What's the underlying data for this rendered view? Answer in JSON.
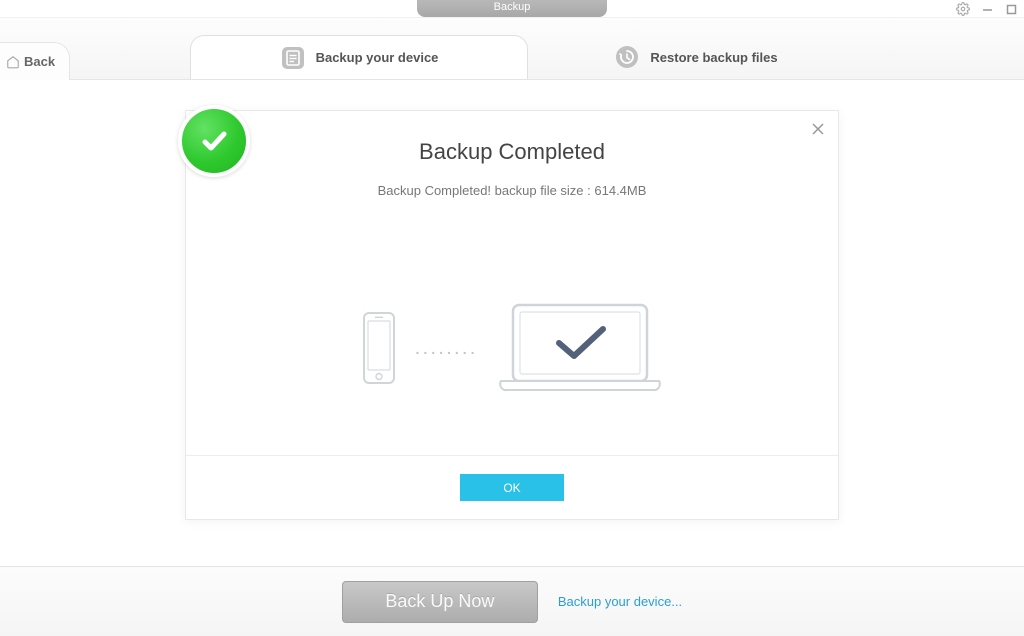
{
  "window": {
    "title": "Backup"
  },
  "nav": {
    "back_label": "Back"
  },
  "tabs": {
    "backup_label": "Backup your device",
    "restore_label": "Restore backup files"
  },
  "dialog": {
    "title": "Backup Completed",
    "subtitle": "Backup Completed! backup file size : 614.4MB",
    "ok_label": "OK",
    "dots": "........"
  },
  "footer": {
    "backup_now_label": "Back Up Now",
    "link_label": "Backup your device..."
  }
}
